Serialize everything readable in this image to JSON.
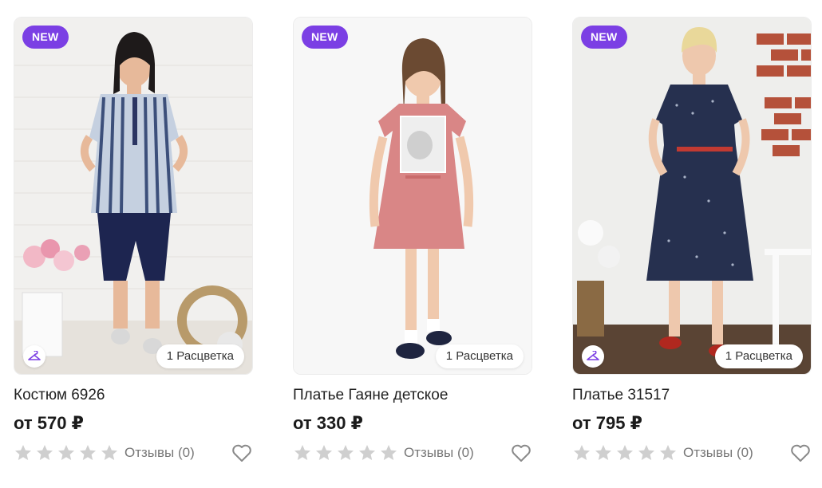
{
  "products": [
    {
      "badge": "NEW",
      "title": "Костюм 6926",
      "price": "от 570 ₽",
      "colors": "1 Расцветка",
      "reviews": "Отзывы (0)",
      "rating": 0,
      "image": "woman-in-striped-tunic-and-navy-capri-pants"
    },
    {
      "badge": "NEW",
      "title": "Платье Гаяне детское",
      "price": "от 330 ₽",
      "colors": "1 Расцветка",
      "reviews": "Отзывы (0)",
      "rating": 0,
      "image": "girl-in-pink-dress"
    },
    {
      "badge": "NEW",
      "title": "Платье 31517",
      "price": "от 795 ₽",
      "colors": "1 Расцветка",
      "reviews": "Отзывы (0)",
      "rating": 0,
      "image": "woman-in-navy-polka-dot-dress"
    }
  ],
  "icons": {
    "badge_color": "#7b3fe4",
    "star_color": "#cfcfcf",
    "heart": "heart-icon",
    "hanger": "hanger-icon"
  }
}
